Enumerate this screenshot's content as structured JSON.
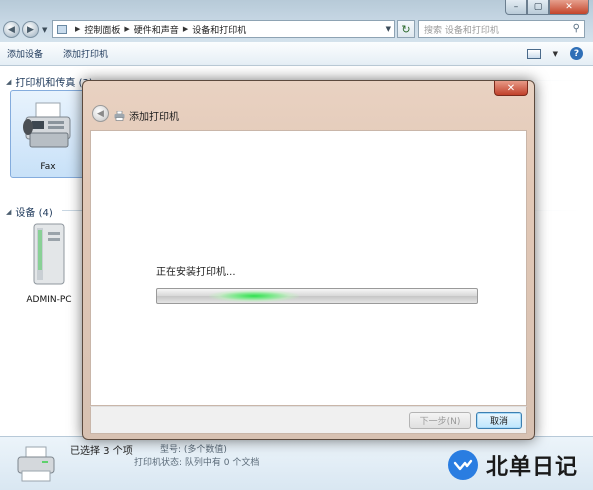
{
  "explorer": {
    "address": {
      "crumbs": [
        "控制面板",
        "硬件和声音",
        "设备和打印机"
      ]
    },
    "search": {
      "placeholder": "搜索 设备和打印机"
    },
    "commands": {
      "add_device": "添加设备",
      "add_printer": "添加打印机"
    }
  },
  "groups": {
    "printers": {
      "header": "打印机和传真 (3)",
      "items": [
        {
          "label": "Fax"
        }
      ]
    },
    "devices": {
      "header": "设备 (4)",
      "items": [
        {
          "label": "ADMIN-PC"
        }
      ]
    }
  },
  "details": {
    "selected_count": "已选择 3 个项",
    "model": "型号: (多个数值)",
    "status": "打印机状态: 队列中有 0 个文档"
  },
  "dialog": {
    "title": "添加打印机",
    "status_text": "正在安装打印机...",
    "next_button": "下一步(N)",
    "cancel_button": "取消",
    "close_glyph": "✕",
    "progress_state": "indeterminate",
    "accent": "#2ee04e"
  },
  "watermark": {
    "text": "北单日记"
  },
  "colors": {
    "explorer_frame": "#c9d9e6",
    "dialog_frame": "#e2c8b6",
    "command_text": "#1e395b"
  }
}
